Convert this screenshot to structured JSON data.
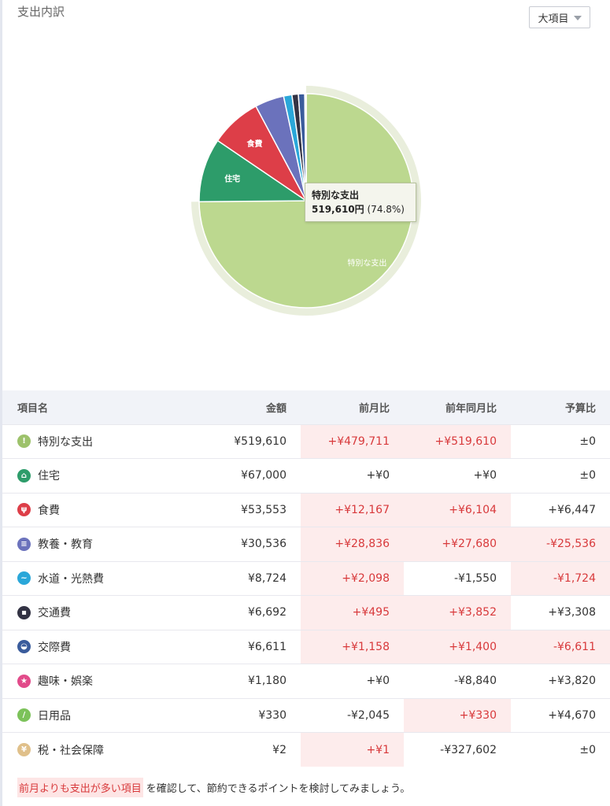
{
  "header": {
    "title": "支出内訳",
    "dropdown_label": "大項目"
  },
  "chart_data": {
    "type": "pie",
    "unit": "円",
    "slices": [
      {
        "label": "特別な支出",
        "value": 519610,
        "color": "#bcd88f"
      },
      {
        "label": "住宅",
        "value": 67000,
        "color": "#2d9c6a"
      },
      {
        "label": "食費",
        "value": 53553,
        "color": "#dd3e48"
      },
      {
        "label": "教養・教育",
        "value": 30536,
        "color": "#6b72bc"
      },
      {
        "label": "水道・光熱費",
        "value": 8724,
        "color": "#2aa7d9"
      },
      {
        "label": "交通費",
        "value": 6692,
        "color": "#333344"
      },
      {
        "label": "交際費",
        "value": 6611,
        "color": "#3a5c9c"
      },
      {
        "label": "趣味・娯楽",
        "value": 1180,
        "color": "#e24b8a"
      },
      {
        "label": "日用品",
        "value": 330,
        "color": "#7cc25a"
      },
      {
        "label": "税・社会保障",
        "value": 2,
        "color": "#e0c08a"
      }
    ],
    "highlighted": "特別な支出",
    "tooltip": {
      "label": "特別な支出",
      "amount": "519,610円",
      "percent": "(74.8%)"
    }
  },
  "table": {
    "headers": [
      "項目名",
      "金額",
      "前月比",
      "前年同月比",
      "予算比"
    ],
    "rows": [
      {
        "name": "特別な支出",
        "icon": "exclamation-icon",
        "color": "#9dc26b",
        "glyph": "!",
        "amount": "¥519,610",
        "prev_month": "+¥479,711",
        "prev_year": "+¥519,610",
        "budget": "±0",
        "hl": [
          true,
          true,
          false
        ]
      },
      {
        "name": "住宅",
        "icon": "house-icon",
        "color": "#2d9c6a",
        "glyph": "⌂",
        "amount": "¥67,000",
        "prev_month": "+¥0",
        "prev_year": "+¥0",
        "budget": "±0",
        "hl": [
          false,
          false,
          false
        ]
      },
      {
        "name": "食費",
        "icon": "fork-knife-icon",
        "color": "#dd3e48",
        "glyph": "ψ",
        "amount": "¥53,553",
        "prev_month": "+¥12,167",
        "prev_year": "+¥6,104",
        "budget": "+¥6,447",
        "hl": [
          true,
          true,
          false
        ]
      },
      {
        "name": "教養・教育",
        "icon": "book-icon",
        "color": "#6b72bc",
        "glyph": "≡",
        "amount": "¥30,536",
        "prev_month": "+¥28,836",
        "prev_year": "+¥27,680",
        "budget": "-¥25,536",
        "hl": [
          true,
          true,
          true
        ]
      },
      {
        "name": "水道・光熱費",
        "icon": "faucet-icon",
        "color": "#2aa7d9",
        "glyph": "~",
        "amount": "¥8,724",
        "prev_month": "+¥2,098",
        "prev_year": "-¥1,550",
        "budget": "-¥1,724",
        "hl": [
          true,
          false,
          true
        ]
      },
      {
        "name": "交通費",
        "icon": "train-icon",
        "color": "#333344",
        "glyph": "▪",
        "amount": "¥6,692",
        "prev_month": "+¥495",
        "prev_year": "+¥3,852",
        "budget": "+¥3,308",
        "hl": [
          true,
          true,
          false
        ]
      },
      {
        "name": "交際費",
        "icon": "people-icon",
        "color": "#3a5c9c",
        "glyph": "◒",
        "amount": "¥6,611",
        "prev_month": "+¥1,158",
        "prev_year": "+¥1,400",
        "budget": "-¥6,611",
        "hl": [
          true,
          true,
          true
        ]
      },
      {
        "name": "趣味・娯楽",
        "icon": "star-icon",
        "color": "#e24b8a",
        "glyph": "★",
        "amount": "¥1,180",
        "prev_month": "+¥0",
        "prev_year": "-¥8,840",
        "budget": "+¥3,820",
        "hl": [
          false,
          false,
          false
        ]
      },
      {
        "name": "日用品",
        "icon": "pill-icon",
        "color": "#7cc25a",
        "glyph": "/",
        "amount": "¥330",
        "prev_month": "-¥2,045",
        "prev_year": "+¥330",
        "budget": "+¥4,670",
        "hl": [
          false,
          true,
          false
        ]
      },
      {
        "name": "税・社会保障",
        "icon": "coin-icon",
        "color": "#e0c08a",
        "glyph": "¥",
        "amount": "¥2",
        "prev_month": "+¥1",
        "prev_year": "-¥327,602",
        "budget": "±0",
        "hl": [
          true,
          false,
          false
        ]
      }
    ]
  },
  "footer": {
    "highlight": "前月よりも支出が多い項目",
    "text": "を確認して、節約できるポイントを検討してみましょう。"
  }
}
